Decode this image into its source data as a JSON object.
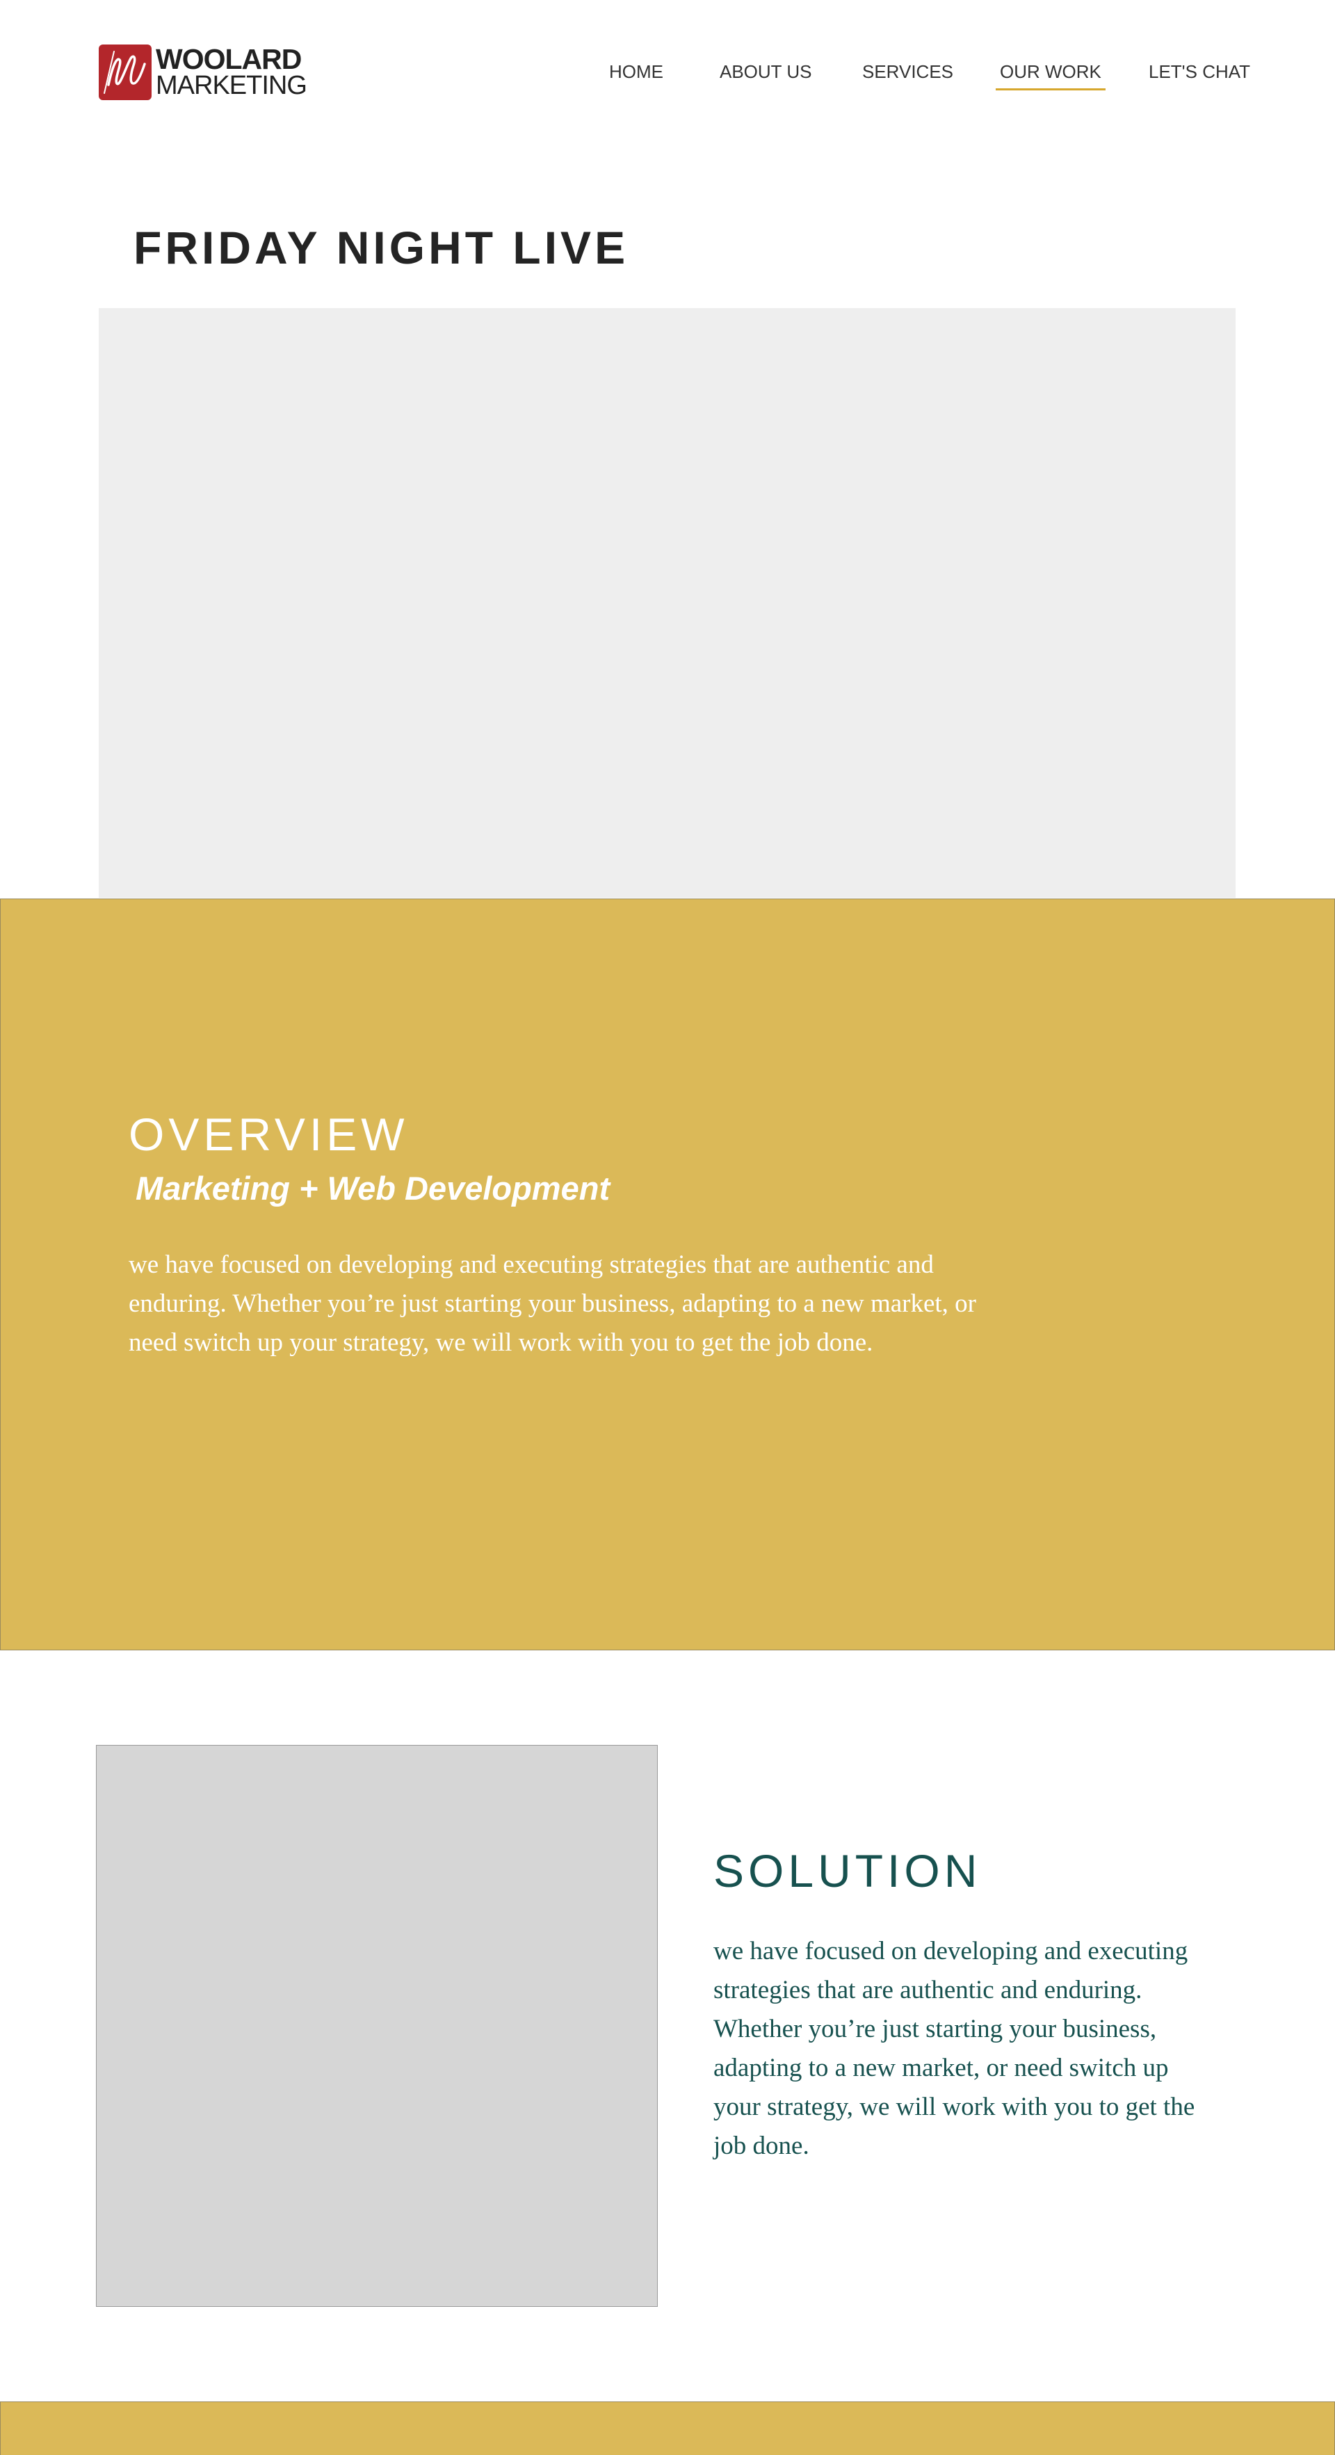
{
  "brand": {
    "name_line1": "WOOLARD",
    "name_line2": "MARKETING",
    "accent_color": "#b3262b"
  },
  "nav": {
    "items": [
      {
        "label": "HOME",
        "active": false
      },
      {
        "label": "ABOUT US",
        "active": false
      },
      {
        "label": "SERVICES",
        "active": false
      },
      {
        "label": "OUR WORK",
        "active": true
      },
      {
        "label": "LET'S CHAT",
        "active": false
      }
    ],
    "active_underline_color": "#d6a72d"
  },
  "page": {
    "title": "FRIDAY NIGHT LIVE"
  },
  "overview": {
    "heading": "OVERVIEW",
    "subheading": "Marketing + Web Development",
    "body": "we have focused on developing and executing strategies that are authentic and enduring. Whether you’re just starting your business, adapting to a new market, or need switch up your strategy, we will work with you to get the job done.",
    "background_color": "#dbb958"
  },
  "solution": {
    "heading": "SOLUTION",
    "body": "we have focused on developing and executing strategies that are authentic and enduring. Whether you’re just starting your business, adapting to a new market, or need switch up your strategy, we will work with you to get the job done.",
    "text_color": "#17514f"
  }
}
